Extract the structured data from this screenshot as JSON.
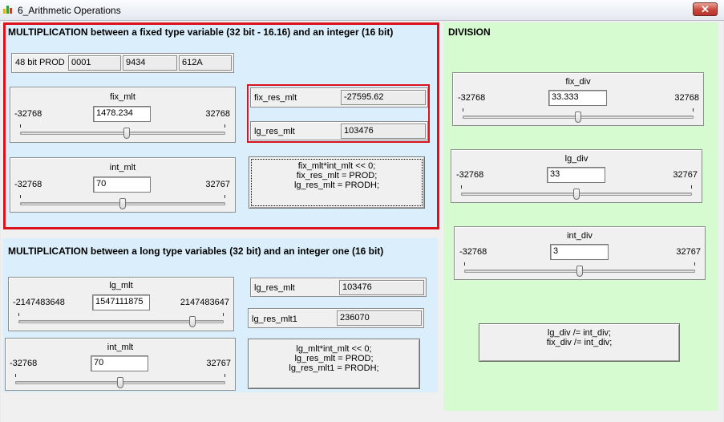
{
  "window": {
    "title": "6_Arithmetic Operations",
    "close_glyph": "✕"
  },
  "mult_fixed": {
    "heading": "MULTIPLICATION between a fixed type variable (32 bit - 16.16) and an integer (16 bit)",
    "prod": {
      "label": "48 bit PROD",
      "values": [
        "0001",
        "9434",
        "612A"
      ]
    },
    "fix_mlt": {
      "label": "fix_mlt",
      "min": "-32768",
      "max": "32768",
      "value": "1478.234",
      "level": 0.52
    },
    "int_mlt": {
      "label": "int_mlt",
      "min": "-32768",
      "max": "32767",
      "value": "70",
      "level": 0.5
    },
    "fix_res_mlt": {
      "label": "fix_res_mlt",
      "value": "-27595.62"
    },
    "lg_res_mlt": {
      "label": "lg_res_mlt",
      "value": "103476"
    },
    "button_lines": [
      "fix_mlt*int_mlt << 0;",
      "fix_res_mlt = PROD;",
      "lg_res_mlt = PRODH;"
    ]
  },
  "mult_long": {
    "heading": "MULTIPLICATION between a long type variables (32 bit) and an integer one (16 bit)",
    "lg_mlt": {
      "label": "lg_mlt",
      "min": "-2147483648",
      "max": "2147483647",
      "value": "1547111875",
      "level": 0.86
    },
    "int_mlt": {
      "label": "int_mlt",
      "min": "-32768",
      "max": "32767",
      "value": "70",
      "level": 0.5
    },
    "lg_res_mlt": {
      "label": "lg_res_mlt",
      "value": "103476"
    },
    "lg_res_mlt1": {
      "label": "lg_res_mlt1",
      "value": "236070"
    },
    "button_lines": [
      "lg_mlt*int_mlt << 0;",
      "lg_res_mlt = PROD;",
      "lg_res_mlt1 = PRODH;"
    ]
  },
  "division": {
    "heading": "DIVISION",
    "fix_div": {
      "label": "fix_div",
      "min": "-32768",
      "max": "32768",
      "value": "33.333",
      "level": 0.5
    },
    "lg_div": {
      "label": "lg_div",
      "min": "-32768",
      "max": "32767",
      "value": "33",
      "level": 0.5
    },
    "int_div": {
      "label": "int_div",
      "min": "-32768",
      "max": "32767",
      "value": "3",
      "level": 0.5
    },
    "button_lines": [
      "lg_div /= int_div;",
      "fix_div /= int_div;"
    ]
  },
  "colors": {
    "highlight": "#d9121b",
    "panel_blue": "#dbeefb",
    "panel_green": "#d7fbd1"
  }
}
